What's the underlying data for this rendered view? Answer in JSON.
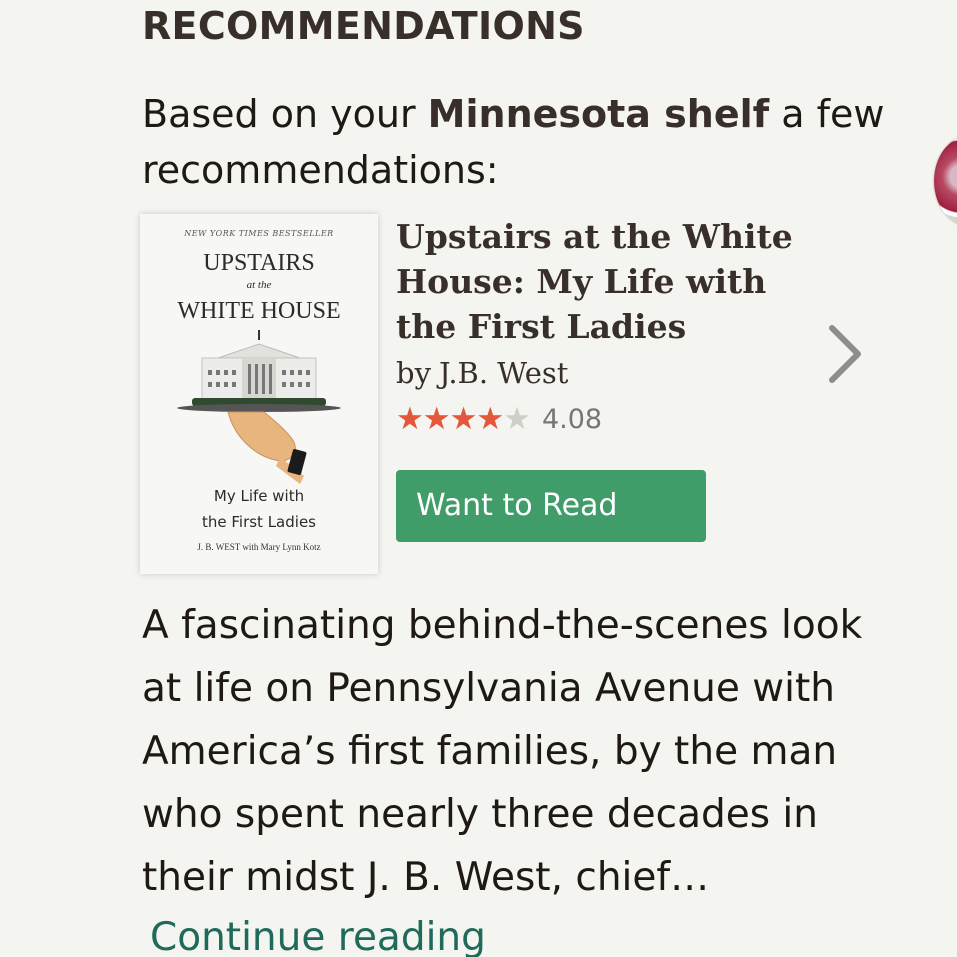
{
  "section": {
    "heading": "RECOMMENDATIONS"
  },
  "intro": {
    "prefix": "Based on your ",
    "shelf_name": "Minnesota shelf",
    "suffix": " a few recommendations:"
  },
  "book": {
    "cover": {
      "tagline": "NEW YORK TIMES BESTSELLER",
      "title_line_1": "UPSTAIRS",
      "title_line_2": "at the",
      "title_line_3": "WHITE HOUSE",
      "subtitle_line_1": "My Life with",
      "subtitle_line_2": "the First Ladies",
      "authors": "J. B. WEST with Mary Lynn Kotz"
    },
    "title": "Upstairs at the White House: My Life with the First Ladies",
    "author_prefix": "by",
    "author": "J.B. West",
    "rating_value": "4.08",
    "rating_fraction": 0.816,
    "want_to_read_label": "Want to Read"
  },
  "description": {
    "text": "A fascinating behind-the-scenes look at life on Pennsylvania Avenue with America’s first families, by the man who spent nearly three decades in their midst J. B. West, chief…",
    "continue_label": "Continue reading"
  },
  "colors": {
    "button_green": "#409d69",
    "star_orange": "#e4573a",
    "link_teal": "#1f6a5a",
    "heading_brown": "#382e2a"
  },
  "icons": {
    "next": "chevron-right-icon",
    "stars": "star-icon"
  }
}
